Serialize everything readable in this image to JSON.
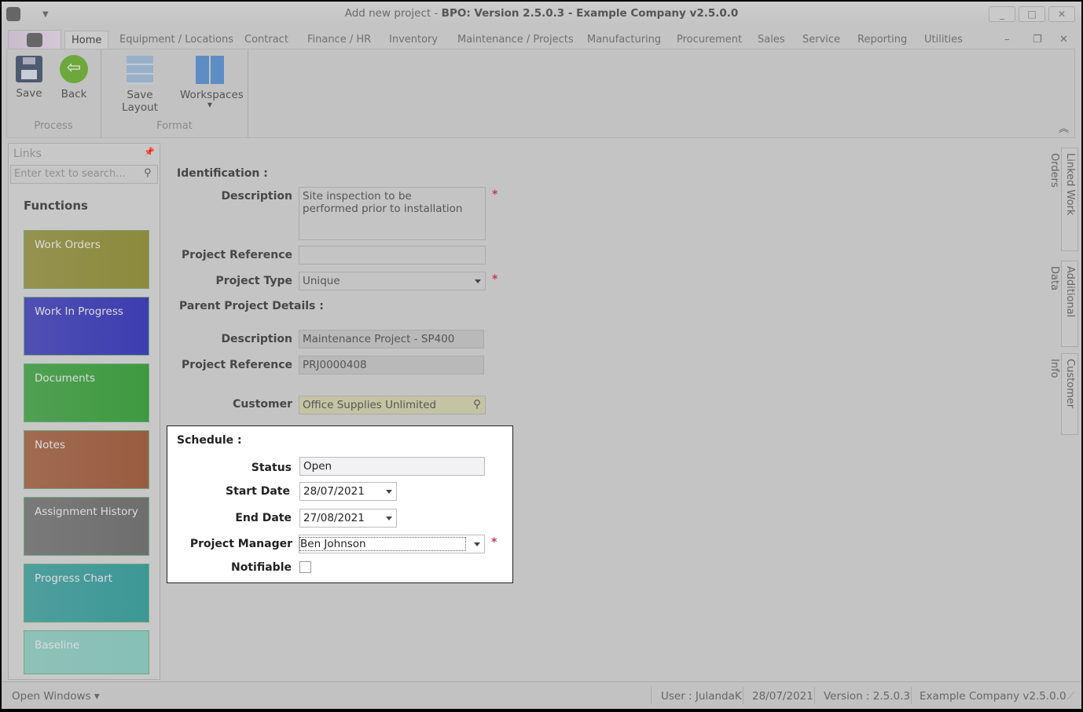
{
  "window": {
    "title_prefix": "Add new project",
    "title_main": "BPO: Version 2.5.0.3 - Example Company v2.5.0.0",
    "minimize": "_",
    "maximize": "□",
    "close": "✕"
  },
  "tabs": [
    "Home",
    "Equipment / Locations",
    "Contract",
    "Finance / HR",
    "Inventory",
    "Maintenance / Projects",
    "Manufacturing",
    "Procurement",
    "Sales",
    "Service",
    "Reporting",
    "Utilities"
  ],
  "ribbon": {
    "save": "Save",
    "back": "Back",
    "save_layout": "Save Layout",
    "workspaces": "Workspaces",
    "group_process": "Process",
    "group_format": "Format"
  },
  "links": {
    "title": "Links",
    "search_placeholder": "Enter text to search...",
    "functions": "Functions",
    "tiles": [
      {
        "label": "Work Orders",
        "color": "#8c8a3c"
      },
      {
        "label": "Work In Progress",
        "color": "#3d3db0"
      },
      {
        "label": "Documents",
        "color": "#3e9a40"
      },
      {
        "label": "Notes",
        "color": "#9a5c40"
      },
      {
        "label": "Assignment History",
        "color": "#6e6e6e"
      },
      {
        "label": "Progress Chart",
        "color": "#3c9896"
      },
      {
        "label": "Baseline",
        "color": "#86c0b6"
      }
    ]
  },
  "form": {
    "identification": "Identification :",
    "description_label": "Description",
    "description_value": "Site inspection to be performed prior to installation",
    "project_reference_label": "Project Reference",
    "project_reference_value": "",
    "project_type_label": "Project Type",
    "project_type_value": "Unique",
    "parent": "Parent Project Details :",
    "parent_description_label": "Description",
    "parent_description_value": "Maintenance Project - SP400",
    "parent_reference_label": "Project Reference",
    "parent_reference_value": "PRJ0000408",
    "customer_label": "Customer",
    "customer_value": "Office Supplies Unlimited",
    "required_mark": "*",
    "schedule": "Schedule :",
    "status_label": "Status",
    "status_value": "Open",
    "start_date_label": "Start Date",
    "start_date_value": "28/07/2021",
    "end_date_label": "End Date",
    "end_date_value": "27/08/2021",
    "manager_label": "Project Manager",
    "manager_value": "Ben Johnson",
    "notifiable_label": "Notifiable",
    "notifiable_checked": false
  },
  "side_tabs": [
    "Linked Work Orders",
    "Additional Data",
    "Customer Info"
  ],
  "statusbar": {
    "open_windows": "Open Windows ▾",
    "user": "User : JulandaK",
    "date": "28/07/2021",
    "version": "Version : 2.5.0.3",
    "company": "Example Company v2.5.0.0"
  }
}
